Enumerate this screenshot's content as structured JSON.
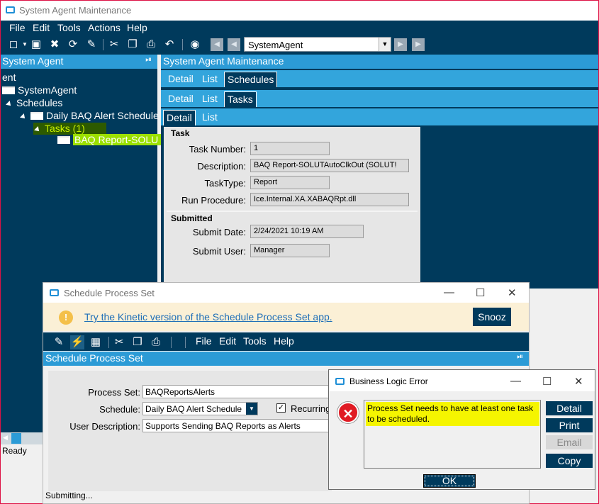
{
  "main_window": {
    "title": "System Agent Maintenance",
    "menu": [
      "File",
      "Edit",
      "Tools",
      "Actions",
      "Help"
    ],
    "combo_value": "SystemAgent",
    "status": "Ready"
  },
  "tree": {
    "header": "System Agent",
    "nodes": {
      "root_partial": "ent",
      "system_agent": "SystemAgent",
      "schedules": "Schedules",
      "daily": "Daily BAQ Alert Schedule",
      "tasks": "Tasks (1)",
      "baq_report": "BAQ Report-SOLU"
    }
  },
  "panel": {
    "title": "System Agent Maintenance",
    "tabrow1": [
      "Detail",
      "List",
      "Schedules"
    ],
    "tabrow2": [
      "Detail",
      "List",
      "Tasks"
    ],
    "tabrow3": [
      "Detail",
      "List"
    ],
    "task_group": "Task",
    "submitted_group": "Submitted",
    "fields": {
      "task_number_label": "Task Number:",
      "task_number": "1",
      "description_label": "Description:",
      "description": "BAQ Report-SOLUTAutoClkOut (SOLUT!",
      "tasktype_label": "TaskType:",
      "tasktype": "Report",
      "run_procedure_label": "Run Procedure:",
      "run_procedure": "Ice.Internal.XA.XABAQRpt.dll",
      "submit_date_label": "Submit Date:",
      "submit_date": "2/24/2021 10:19 AM",
      "submit_user_label": "Submit User:",
      "submit_user": "Manager"
    }
  },
  "sps": {
    "title": "Schedule Process Set",
    "banner_text": "Try the Kinetic version of the Schedule Process Set app.",
    "snooze": "Snooz",
    "menu": [
      "File",
      "Edit",
      "Tools",
      "Help"
    ],
    "header": "Schedule Process Set",
    "process_set_label": "Process Set:",
    "process_set": "BAQReportsAlerts",
    "schedule_label": "Schedule:",
    "schedule": "Daily BAQ Alert Schedule",
    "recurring_label": "Recurring",
    "user_desc_label": "User Description:",
    "user_desc": "Supports Sending BAQ Reports as Alerts",
    "status": "Submitting..."
  },
  "error": {
    "title": "Business Logic Error",
    "message": "Process Set needs to have at least one task to be scheduled.",
    "buttons": {
      "detail": "Detail",
      "print": "Print",
      "email": "Email",
      "copy": "Copy"
    },
    "ok": "OK"
  },
  "colors": {
    "navy": "#003a5c",
    "accent_blue": "#2c9bd6",
    "highlight_yellow": "#f5f500",
    "tree_highlight": "#9be000"
  }
}
